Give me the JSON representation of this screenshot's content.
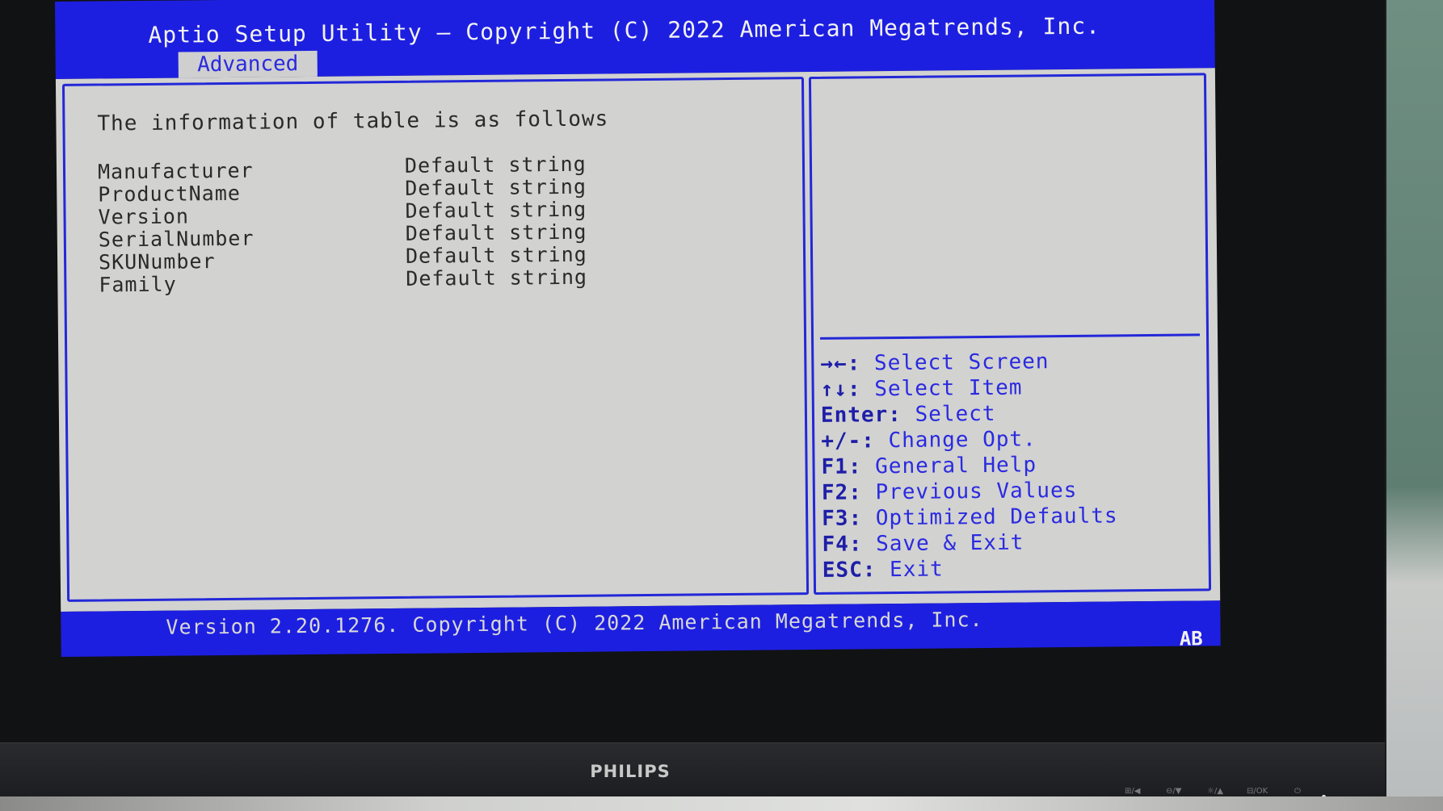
{
  "bios": {
    "title": "Aptio Setup Utility – Copyright (C) 2022 American Megatrends, Inc.",
    "active_tab": "Advanced",
    "heading": "The information of table is as follows",
    "rows": [
      {
        "label": "Manufacturer",
        "value": "Default string"
      },
      {
        "label": "ProductName",
        "value": "Default string"
      },
      {
        "label": "Version",
        "value": "Default string"
      },
      {
        "label": "SerialNumber",
        "value": "Default string"
      },
      {
        "label": "SKUNumber",
        "value": "Default string"
      },
      {
        "label": "Family",
        "value": "Default string"
      }
    ],
    "help": [
      {
        "key": "→←:",
        "text": " Select Screen"
      },
      {
        "key": "↑↓:",
        "text": " Select Item"
      },
      {
        "key": "Enter:",
        "text": " Select"
      },
      {
        "key": "+/-:",
        "text": " Change Opt."
      },
      {
        "key": "F1:",
        "text": " General Help"
      },
      {
        "key": "F2:",
        "text": " Previous Values"
      },
      {
        "key": "F3:",
        "text": " Optimized Defaults"
      },
      {
        "key": "F4:",
        "text": " Save & Exit"
      },
      {
        "key": "ESC:",
        "text": " Exit"
      }
    ],
    "footer": "Version 2.20.1276. Copyright (C) 2022 American Megatrends, Inc.",
    "footer_badge": "AB"
  },
  "monitor": {
    "brand": "PHILIPS",
    "controls": [
      "⊞/◀",
      "⊖/▼",
      "☼/▲",
      "⊟/OK",
      "⏻"
    ]
  },
  "colors": {
    "bios_blue": "#1d1fe0",
    "panel_gray": "#d2d2d1",
    "border_blue": "#2328d8"
  }
}
